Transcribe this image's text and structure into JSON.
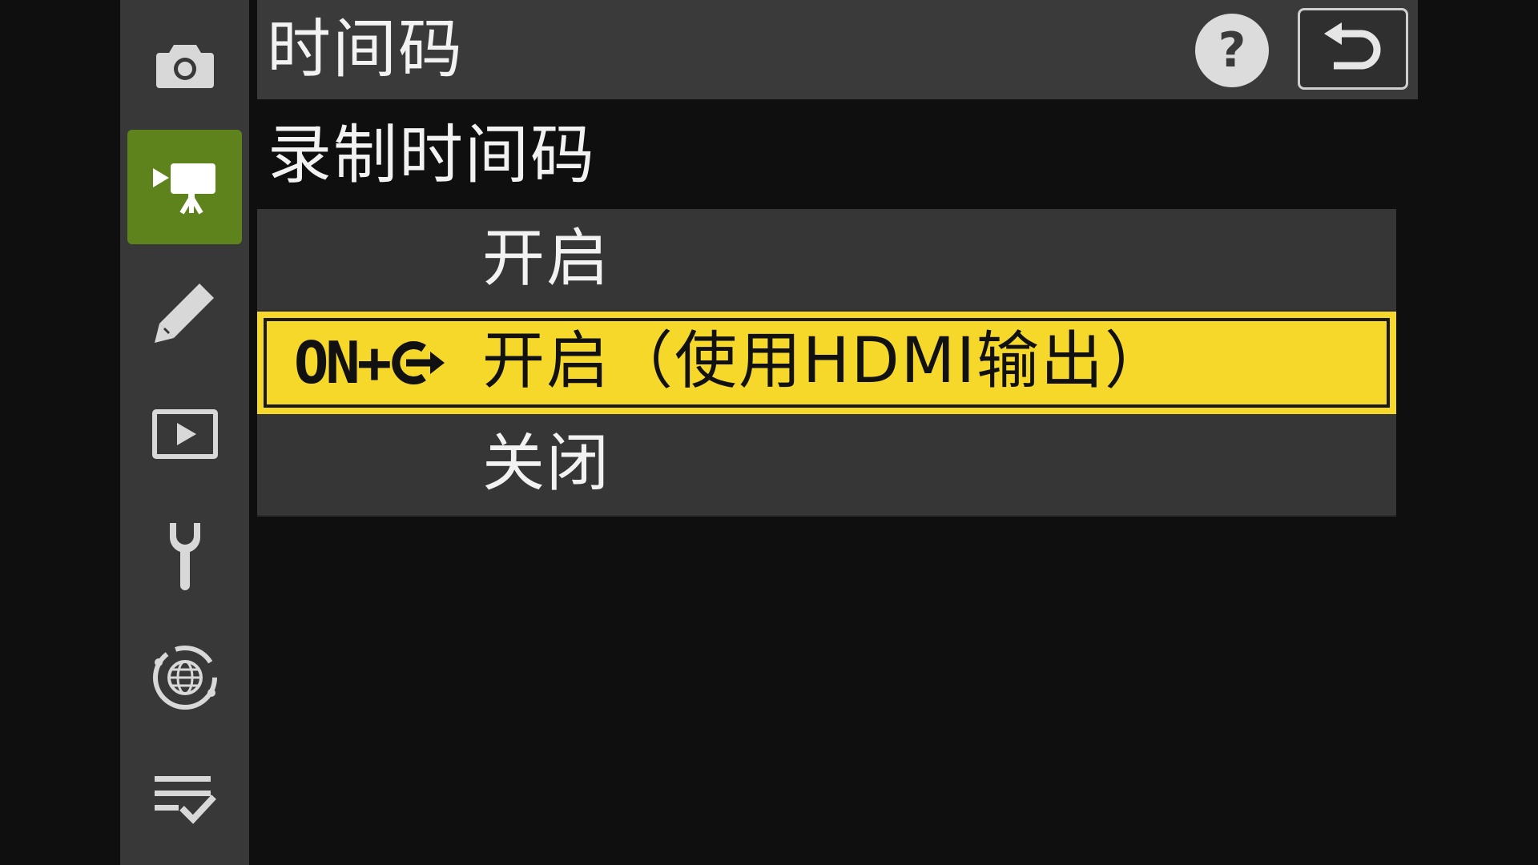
{
  "header": {
    "title": "时间码",
    "help_glyph": "?"
  },
  "sub_heading": "录制时间码",
  "options": [
    {
      "label": "开启",
      "prefix": ""
    },
    {
      "label": "开启（使用HDMI输出）",
      "prefix": "ON+"
    },
    {
      "label": "关闭",
      "prefix": ""
    }
  ],
  "selected_option_index": 1,
  "sidebar": {
    "items": [
      {
        "icon": "camera-icon"
      },
      {
        "icon": "movie-camera-icon",
        "active": true
      },
      {
        "icon": "pencil-icon"
      },
      {
        "icon": "playback-icon"
      },
      {
        "icon": "wrench-icon"
      },
      {
        "icon": "network-globe-icon"
      },
      {
        "icon": "checklist-icon"
      }
    ]
  },
  "colors": {
    "accent_green": "#5e821c",
    "highlight_yellow": "#f5d82a",
    "background": "#0f0f0f",
    "panel": "#363636"
  }
}
